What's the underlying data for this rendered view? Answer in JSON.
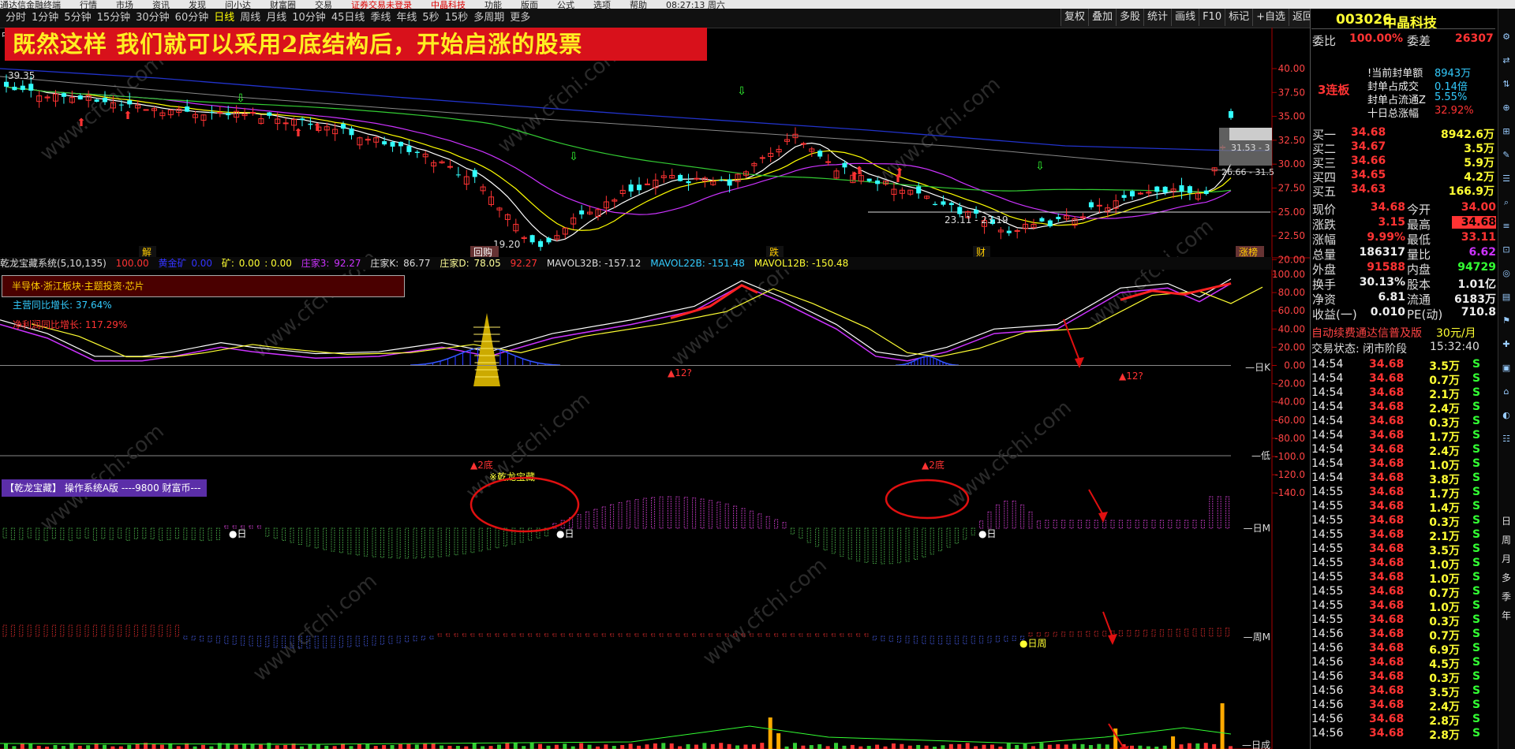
{
  "menubar": {
    "items": [
      "通达信金融终端",
      "行情",
      "市场",
      "资讯",
      "发现",
      "问小达",
      "财富圈",
      "交易",
      "证券交易未登录",
      "中晶科技",
      "功能",
      "版面",
      "公式",
      "选项",
      "帮助",
      "08:27:13 周六"
    ]
  },
  "periods": {
    "items": [
      "分时",
      "1分钟",
      "5分钟",
      "15分钟",
      "30分钟",
      "60分钟",
      "日线",
      "周线",
      "月线",
      "10分钟",
      "45日线",
      "季线",
      "年线",
      "5秒",
      "15秒",
      "多周期",
      "更多"
    ],
    "active": "日线"
  },
  "toolbar": {
    "items": [
      "复权",
      "叠加",
      "多股",
      "统计",
      "画线",
      "F10",
      "标记",
      "+自选",
      "返回"
    ]
  },
  "banner": {
    "text": "既然这样  我们就可以采用2底结构后，开始启涨的股票"
  },
  "price_chart": {
    "corner_label": "中",
    "high_label": "39.35",
    "low_label": "19.20",
    "range_label_1": "23.11 - 23.19",
    "range_label_2": "31.53 - 3",
    "range_label_3": "26.66 - 31.5",
    "event_labels": [
      "解",
      "回购",
      "跌",
      "财",
      "涨榜"
    ],
    "y_ticks": [
      "40.00",
      "37.50",
      "35.00",
      "32.50",
      "30.00",
      "27.50",
      "25.00",
      "22.50",
      "20.00"
    ]
  },
  "indicator_line": {
    "name": "乾龙宝藏系统(5,10,135)",
    "v1": "100.00",
    "label2": "黄金矿",
    "v2": "0.00",
    "label3": "矿:",
    "v3": "0.00",
    "v4": ": 0.00",
    "zj3_label": "庄家3:",
    "zj3": "92.27",
    "zjk_label": "庄家K:",
    "zjk": "86.77",
    "zjd_label": "庄家D:",
    "zjd": "78.05",
    "v5": "92.27",
    "mav32": "MAVOL32B: -157.12",
    "mav22": "MAVOL22B: -151.48",
    "mav12": "MAVOL12B: -150.48"
  },
  "info": {
    "concept": "半导体·浙江板块·主题投资·芯片",
    "revenue": "主营同比增长: 37.64%",
    "profit": "净利润同比增长: 117.29%"
  },
  "indicator_chart": {
    "y_ticks": [
      "100.00",
      "80.00",
      "60.00",
      "40.00",
      "20.00",
      "0.00",
      "-20.00",
      "-40.00",
      "-60.00",
      "-80.00",
      "-100.0",
      "-120.0",
      "-140.0"
    ],
    "side_labels": [
      "日K",
      "低",
      "日M",
      "周M",
      "日成"
    ],
    "low_markers": [
      "▲2底",
      "▲2底"
    ],
    "up_markers": [
      "▲12?",
      "▲12?"
    ],
    "treasure_label": "※乾龙宝藏",
    "day_labels": [
      "●日",
      "●日",
      "●日",
      "●日周"
    ]
  },
  "system_box": {
    "text": "【乾龙宝藏】 操作系统A版 ----9800 财富币---"
  },
  "quote": {
    "code": "003026",
    "name": "中晶科技",
    "webi_label": "委比",
    "webi": "100.00%",
    "wecha_label": "委差",
    "wecha": "26307",
    "lianban": "3连板",
    "seal_lines": [
      {
        "label": "!当前封单额",
        "value": "8943万"
      },
      {
        "label": "封单占成交",
        "value": "0.14倍"
      },
      {
        "label": "封单占流通Z",
        "value": "5.55%"
      },
      {
        "label": "十日总涨幅",
        "value": "32.92%"
      }
    ],
    "buys": [
      {
        "label": "买一",
        "price": "34.68",
        "vol": "8942.6万"
      },
      {
        "label": "买二",
        "price": "34.67",
        "vol": "3.5万"
      },
      {
        "label": "买三",
        "price": "34.66",
        "vol": "5.9万"
      },
      {
        "label": "买四",
        "price": "34.65",
        "vol": "4.2万"
      },
      {
        "label": "买五",
        "price": "34.63",
        "vol": "166.9万"
      }
    ],
    "stats": [
      {
        "l1": "现价",
        "v1": "34.68",
        "l2": "今开",
        "v2": "34.00"
      },
      {
        "l1": "涨跌",
        "v1": "3.15",
        "l2": "最高",
        "v2": "34.68"
      },
      {
        "l1": "涨幅",
        "v1": "9.99%",
        "l2": "最低",
        "v2": "33.11"
      },
      {
        "l1": "总量",
        "v1": "186317",
        "l2": "量比",
        "v2": "6.62"
      },
      {
        "l1": "外盘",
        "v1": "91588",
        "l2": "内盘",
        "v2": "94729"
      },
      {
        "l1": "换手",
        "v1": "30.13%",
        "l2": "股本",
        "v2": "1.01亿"
      },
      {
        "l1": "净资",
        "v1": "6.81",
        "l2": "流通",
        "v2": "6183万"
      },
      {
        "l1": "收益(一)",
        "v1": "0.010",
        "l2": "PE(动)",
        "v2": "710.8"
      }
    ],
    "promo": "自动续费通达信普及版",
    "promo_price": "30元/月",
    "trade_status": "交易状态: 闭市阶段",
    "trade_time": "15:32:40"
  },
  "ticks": [
    {
      "t": "14:54",
      "p": "34.68",
      "v": "3.5万",
      "s": "S"
    },
    {
      "t": "14:54",
      "p": "34.68",
      "v": "0.7万",
      "s": "S"
    },
    {
      "t": "14:54",
      "p": "34.68",
      "v": "2.1万",
      "s": "S"
    },
    {
      "t": "14:54",
      "p": "34.68",
      "v": "2.4万",
      "s": "S"
    },
    {
      "t": "14:54",
      "p": "34.68",
      "v": "0.3万",
      "s": "S"
    },
    {
      "t": "14:54",
      "p": "34.68",
      "v": "1.7万",
      "s": "S"
    },
    {
      "t": "14:54",
      "p": "34.68",
      "v": "2.4万",
      "s": "S"
    },
    {
      "t": "14:54",
      "p": "34.68",
      "v": "1.0万",
      "s": "S"
    },
    {
      "t": "14:54",
      "p": "34.68",
      "v": "3.8万",
      "s": "S"
    },
    {
      "t": "14:55",
      "p": "34.68",
      "v": "1.7万",
      "s": "S"
    },
    {
      "t": "14:55",
      "p": "34.68",
      "v": "1.4万",
      "s": "S"
    },
    {
      "t": "14:55",
      "p": "34.68",
      "v": "0.3万",
      "s": "S"
    },
    {
      "t": "14:55",
      "p": "34.68",
      "v": "2.1万",
      "s": "S"
    },
    {
      "t": "14:55",
      "p": "34.68",
      "v": "3.5万",
      "s": "S"
    },
    {
      "t": "14:55",
      "p": "34.68",
      "v": "1.0万",
      "s": "S"
    },
    {
      "t": "14:55",
      "p": "34.68",
      "v": "1.0万",
      "s": "S"
    },
    {
      "t": "14:55",
      "p": "34.68",
      "v": "0.7万",
      "s": "S"
    },
    {
      "t": "14:55",
      "p": "34.68",
      "v": "1.0万",
      "s": "S"
    },
    {
      "t": "14:55",
      "p": "34.68",
      "v": "0.3万",
      "s": "S"
    },
    {
      "t": "14:56",
      "p": "34.68",
      "v": "0.7万",
      "s": "S"
    },
    {
      "t": "14:56",
      "p": "34.68",
      "v": "6.9万",
      "s": "S"
    },
    {
      "t": "14:56",
      "p": "34.68",
      "v": "4.5万",
      "s": "S"
    },
    {
      "t": "14:56",
      "p": "34.68",
      "v": "0.3万",
      "s": "S"
    },
    {
      "t": "14:56",
      "p": "34.68",
      "v": "3.5万",
      "s": "S"
    },
    {
      "t": "14:56",
      "p": "34.68",
      "v": "2.4万",
      "s": "S"
    },
    {
      "t": "14:56",
      "p": "34.68",
      "v": "2.8万",
      "s": "S"
    },
    {
      "t": "14:56",
      "p": "34.68",
      "v": "2.8万",
      "s": "S"
    }
  ],
  "sidebar": {
    "items": [
      "日",
      "周",
      "月",
      "多",
      "季",
      "年"
    ]
  },
  "watermark": "www.cfchi.com",
  "colors": {
    "up": "#ff3333",
    "down": "#33ffff",
    "ma1": "#ffffff",
    "ma2": "#ffff00",
    "ma3": "#cc33ff",
    "ma4": "#33cc33",
    "ma5": "#888888",
    "ma6": "#2233cc"
  }
}
